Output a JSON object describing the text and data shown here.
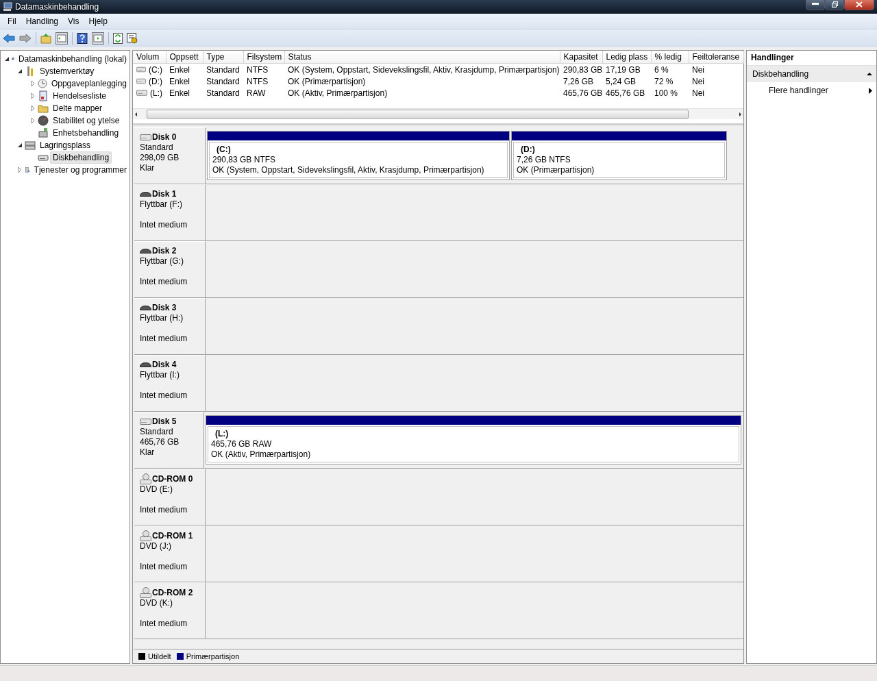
{
  "window": {
    "title": "Datamaskinbehandling"
  },
  "menu": [
    "Fil",
    "Handling",
    "Vis",
    "Hjelp"
  ],
  "tree": [
    {
      "label": "Datamaskinbehandling (lokal)",
      "kind": "computer",
      "expanded": true,
      "selected": false,
      "children": [
        {
          "label": "Systemverktøy",
          "kind": "tools",
          "expanded": true,
          "selected": false,
          "children": [
            {
              "label": "Oppgaveplanlegging",
              "kind": "clock",
              "expanded": false,
              "selected": false
            },
            {
              "label": "Hendelsesliste",
              "kind": "log",
              "expanded": false,
              "selected": false
            },
            {
              "label": "Delte mapper",
              "kind": "folder",
              "expanded": false,
              "selected": false
            },
            {
              "label": "Stabilitet og ytelse",
              "kind": "gauge",
              "expanded": false,
              "selected": false
            },
            {
              "label": "Enhetsbehandling",
              "kind": "device",
              "selected": false
            }
          ]
        },
        {
          "label": "Lagringsplass",
          "kind": "storage",
          "expanded": true,
          "selected": false,
          "children": [
            {
              "label": "Diskbehandling",
              "kind": "disk",
              "selected": true
            }
          ]
        },
        {
          "label": "Tjenester og programmer",
          "kind": "services",
          "expanded": false,
          "selected": false
        }
      ]
    }
  ],
  "volume_table": {
    "columns": [
      "Volum",
      "Oppsett",
      "Type",
      "Filsystem",
      "Status",
      "Kapasitet",
      "Ledig plass",
      "% ledig",
      "Feiltoleranse"
    ],
    "rows": [
      [
        "(C:)",
        "Enkel",
        "Standard",
        "NTFS",
        "OK (System, Oppstart, Sidevekslingsfil, Aktiv, Krasjdump, Primærpartisjon)",
        "290,83 GB",
        "17,19 GB",
        "6 %",
        "Nei"
      ],
      [
        "(D:)",
        "Enkel",
        "Standard",
        "NTFS",
        "OK (Primærpartisjon)",
        "7,26 GB",
        "5,24 GB",
        "72 %",
        "Nei"
      ],
      [
        "(L:)",
        "Enkel",
        "Standard",
        "RAW",
        "OK (Aktiv, Primærpartisjon)",
        "465,76 GB",
        "465,76 GB",
        "100 %",
        "Nei"
      ]
    ]
  },
  "disks": [
    {
      "name": "Disk 0",
      "kind": "disk",
      "type": "Standard",
      "size": "298,09 GB",
      "status": "Klar",
      "partitions": [
        {
          "label": "(C:)",
          "size": "290,83 GB NTFS",
          "status": "OK (System, Oppstart, Sidevekslingsfil, Aktiv, Krasjdump, Primærpartisjon)",
          "color": "#000080"
        },
        {
          "label": "(D:)",
          "size": "7,26 GB NTFS",
          "status": "OK (Primærpartisjon)",
          "color": "#000080"
        }
      ]
    },
    {
      "name": "Disk 1",
      "kind": "removable",
      "type": "Flyttbar (F:)",
      "status": "Intet medium"
    },
    {
      "name": "Disk 2",
      "kind": "removable",
      "type": "Flyttbar (G:)",
      "status": "Intet medium"
    },
    {
      "name": "Disk 3",
      "kind": "removable",
      "type": "Flyttbar (H:)",
      "status": "Intet medium"
    },
    {
      "name": "Disk 4",
      "kind": "removable",
      "type": "Flyttbar (I:)",
      "status": "Intet medium"
    },
    {
      "name": "Disk 5",
      "kind": "disk",
      "type": "Standard",
      "size": "465,76 GB",
      "status": "Klar",
      "partitions": [
        {
          "label": "(L:)",
          "size": "465,76 GB RAW",
          "status": "OK (Aktiv, Primærpartisjon)",
          "color": "#000080"
        }
      ]
    },
    {
      "name": "CD-ROM 0",
      "kind": "cdrom",
      "type": "DVD (E:)",
      "status": "Intet medium"
    },
    {
      "name": "CD-ROM 1",
      "kind": "cdrom",
      "type": "DVD (J:)",
      "status": "Intet medium"
    },
    {
      "name": "CD-ROM 2",
      "kind": "cdrom",
      "type": "DVD (K:)",
      "status": "Intet medium"
    }
  ],
  "legend": [
    {
      "label": "Utildelt",
      "color": "#000000"
    },
    {
      "label": "Primærpartisjon",
      "color": "#000080"
    }
  ],
  "actions": {
    "title": "Handlinger",
    "section": {
      "label": "Diskbehandling",
      "expanded": true
    },
    "items": [
      "Flere handlinger"
    ]
  }
}
